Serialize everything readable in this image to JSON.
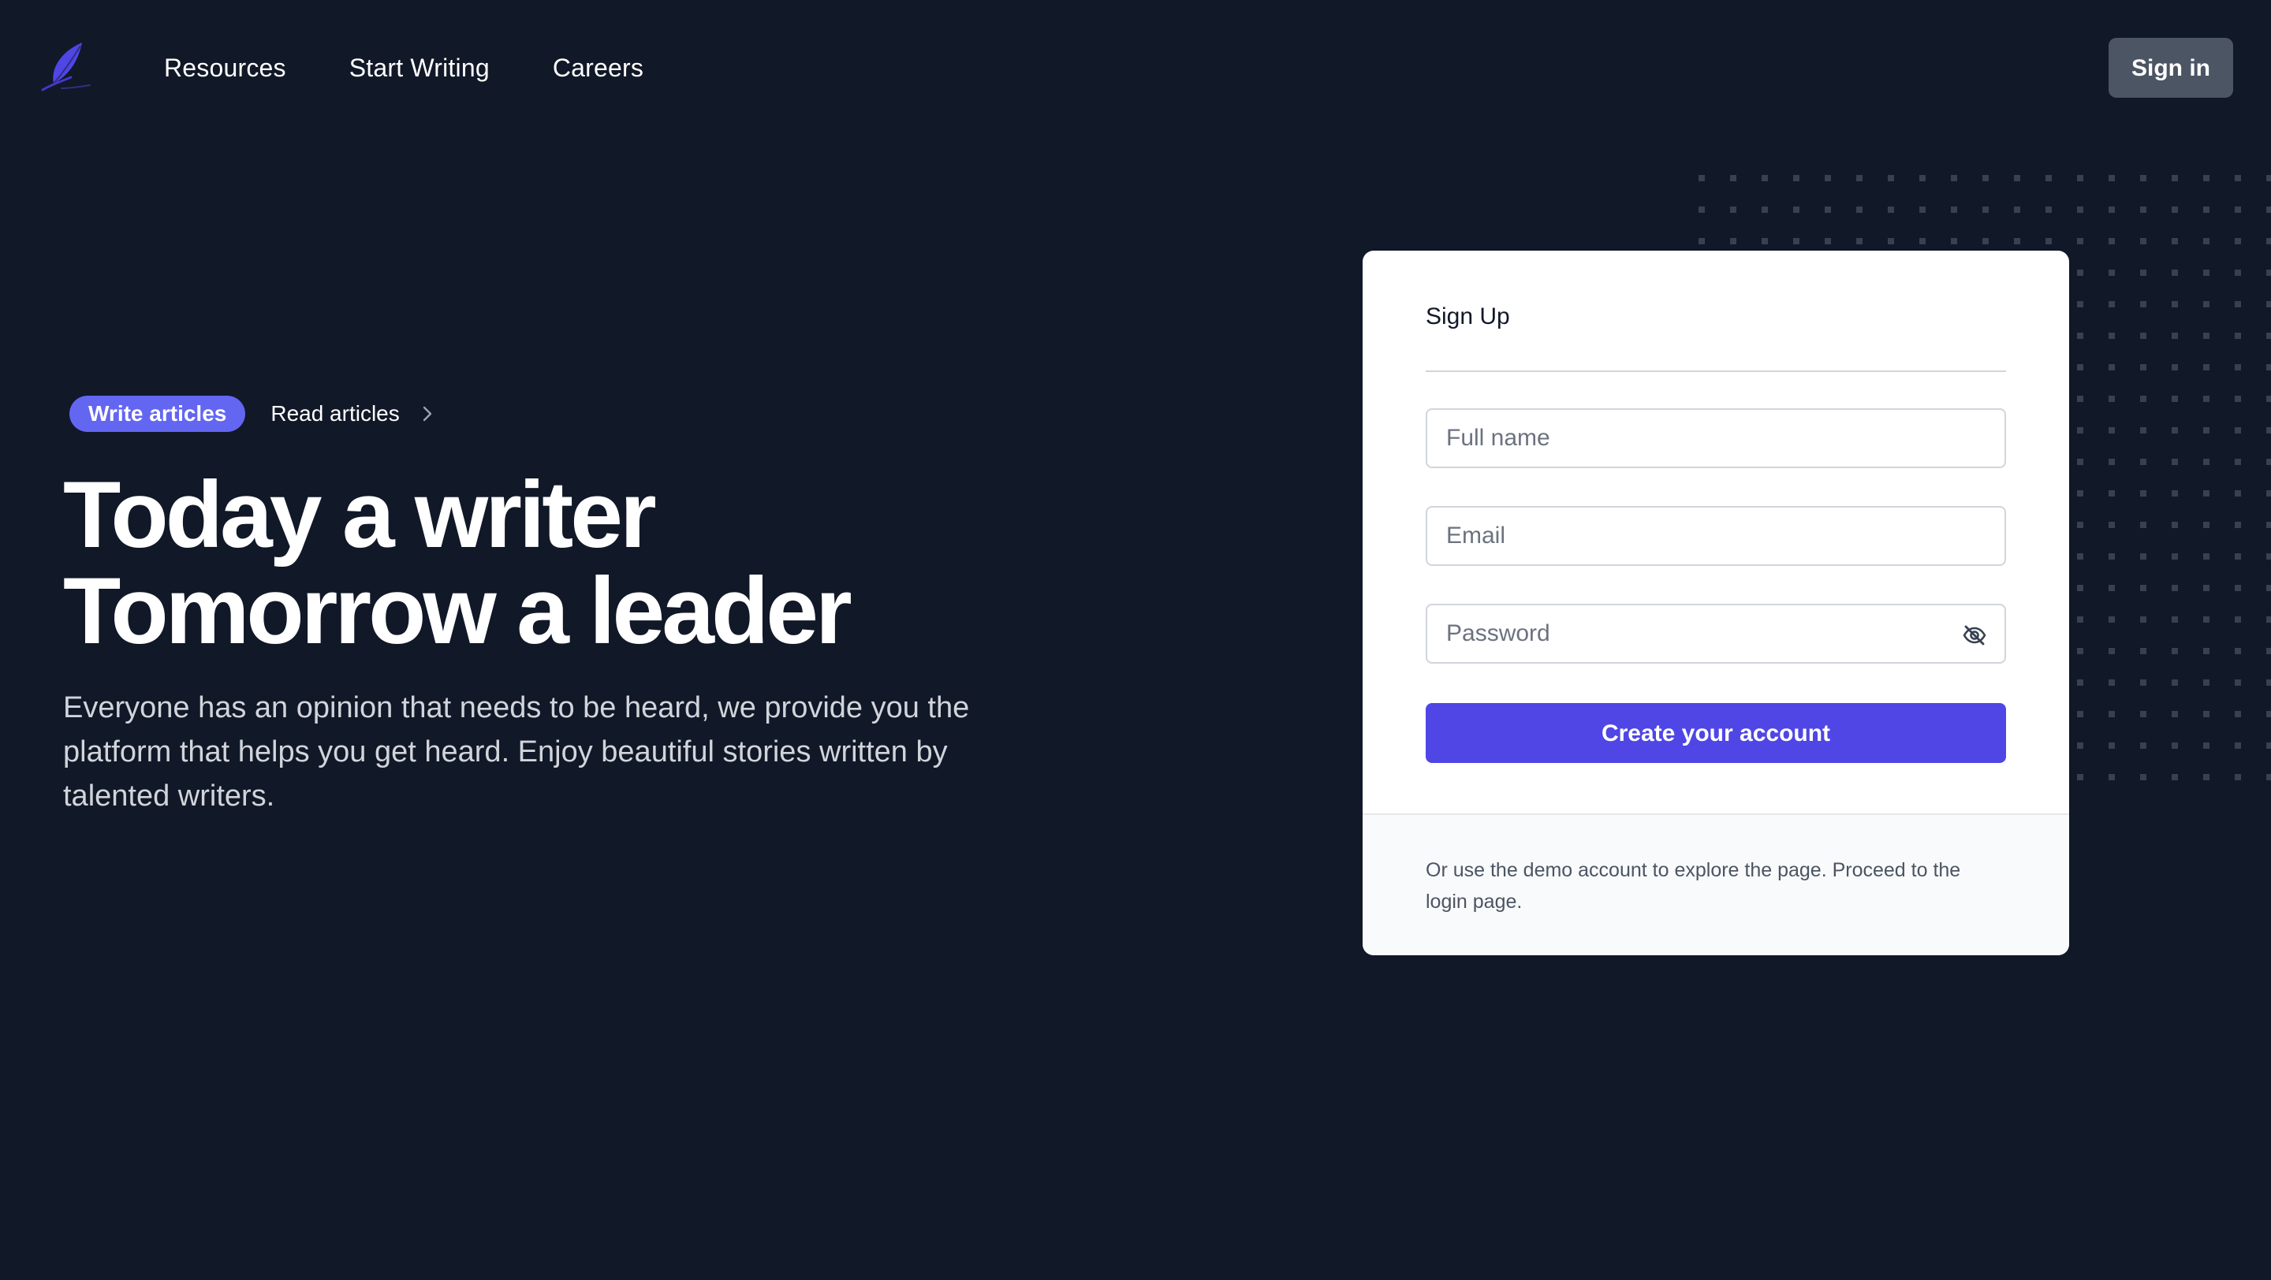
{
  "header": {
    "logo_icon": "feather-quill-icon",
    "nav": [
      {
        "label": "Resources"
      },
      {
        "label": "Start Writing"
      },
      {
        "label": "Careers"
      }
    ],
    "signin_label": "Sign in"
  },
  "hero": {
    "pill_label": "Write articles",
    "link_label": "Read articles",
    "link_icon": "chevron-right-icon",
    "title_line1": "Today a writer",
    "title_line2": "Tomorrow a leader",
    "description": "Everyone has an opinion that needs to be heard, we provide you the platform that helps you get heard. Enjoy beautiful stories written by talented writers."
  },
  "signup": {
    "title": "Sign Up",
    "fullname_placeholder": "Full name",
    "email_placeholder": "Email",
    "password_placeholder": "Password",
    "password_toggle_icon": "eye-slash-icon",
    "submit_label": "Create your account",
    "footer_text": "Or use the demo account to explore the page. Proceed to the login page."
  },
  "colors": {
    "background": "#111827",
    "accent": "#4f46e5",
    "pill": "#6366f1",
    "signin_button": "#4b5563",
    "dots": "#374151"
  }
}
